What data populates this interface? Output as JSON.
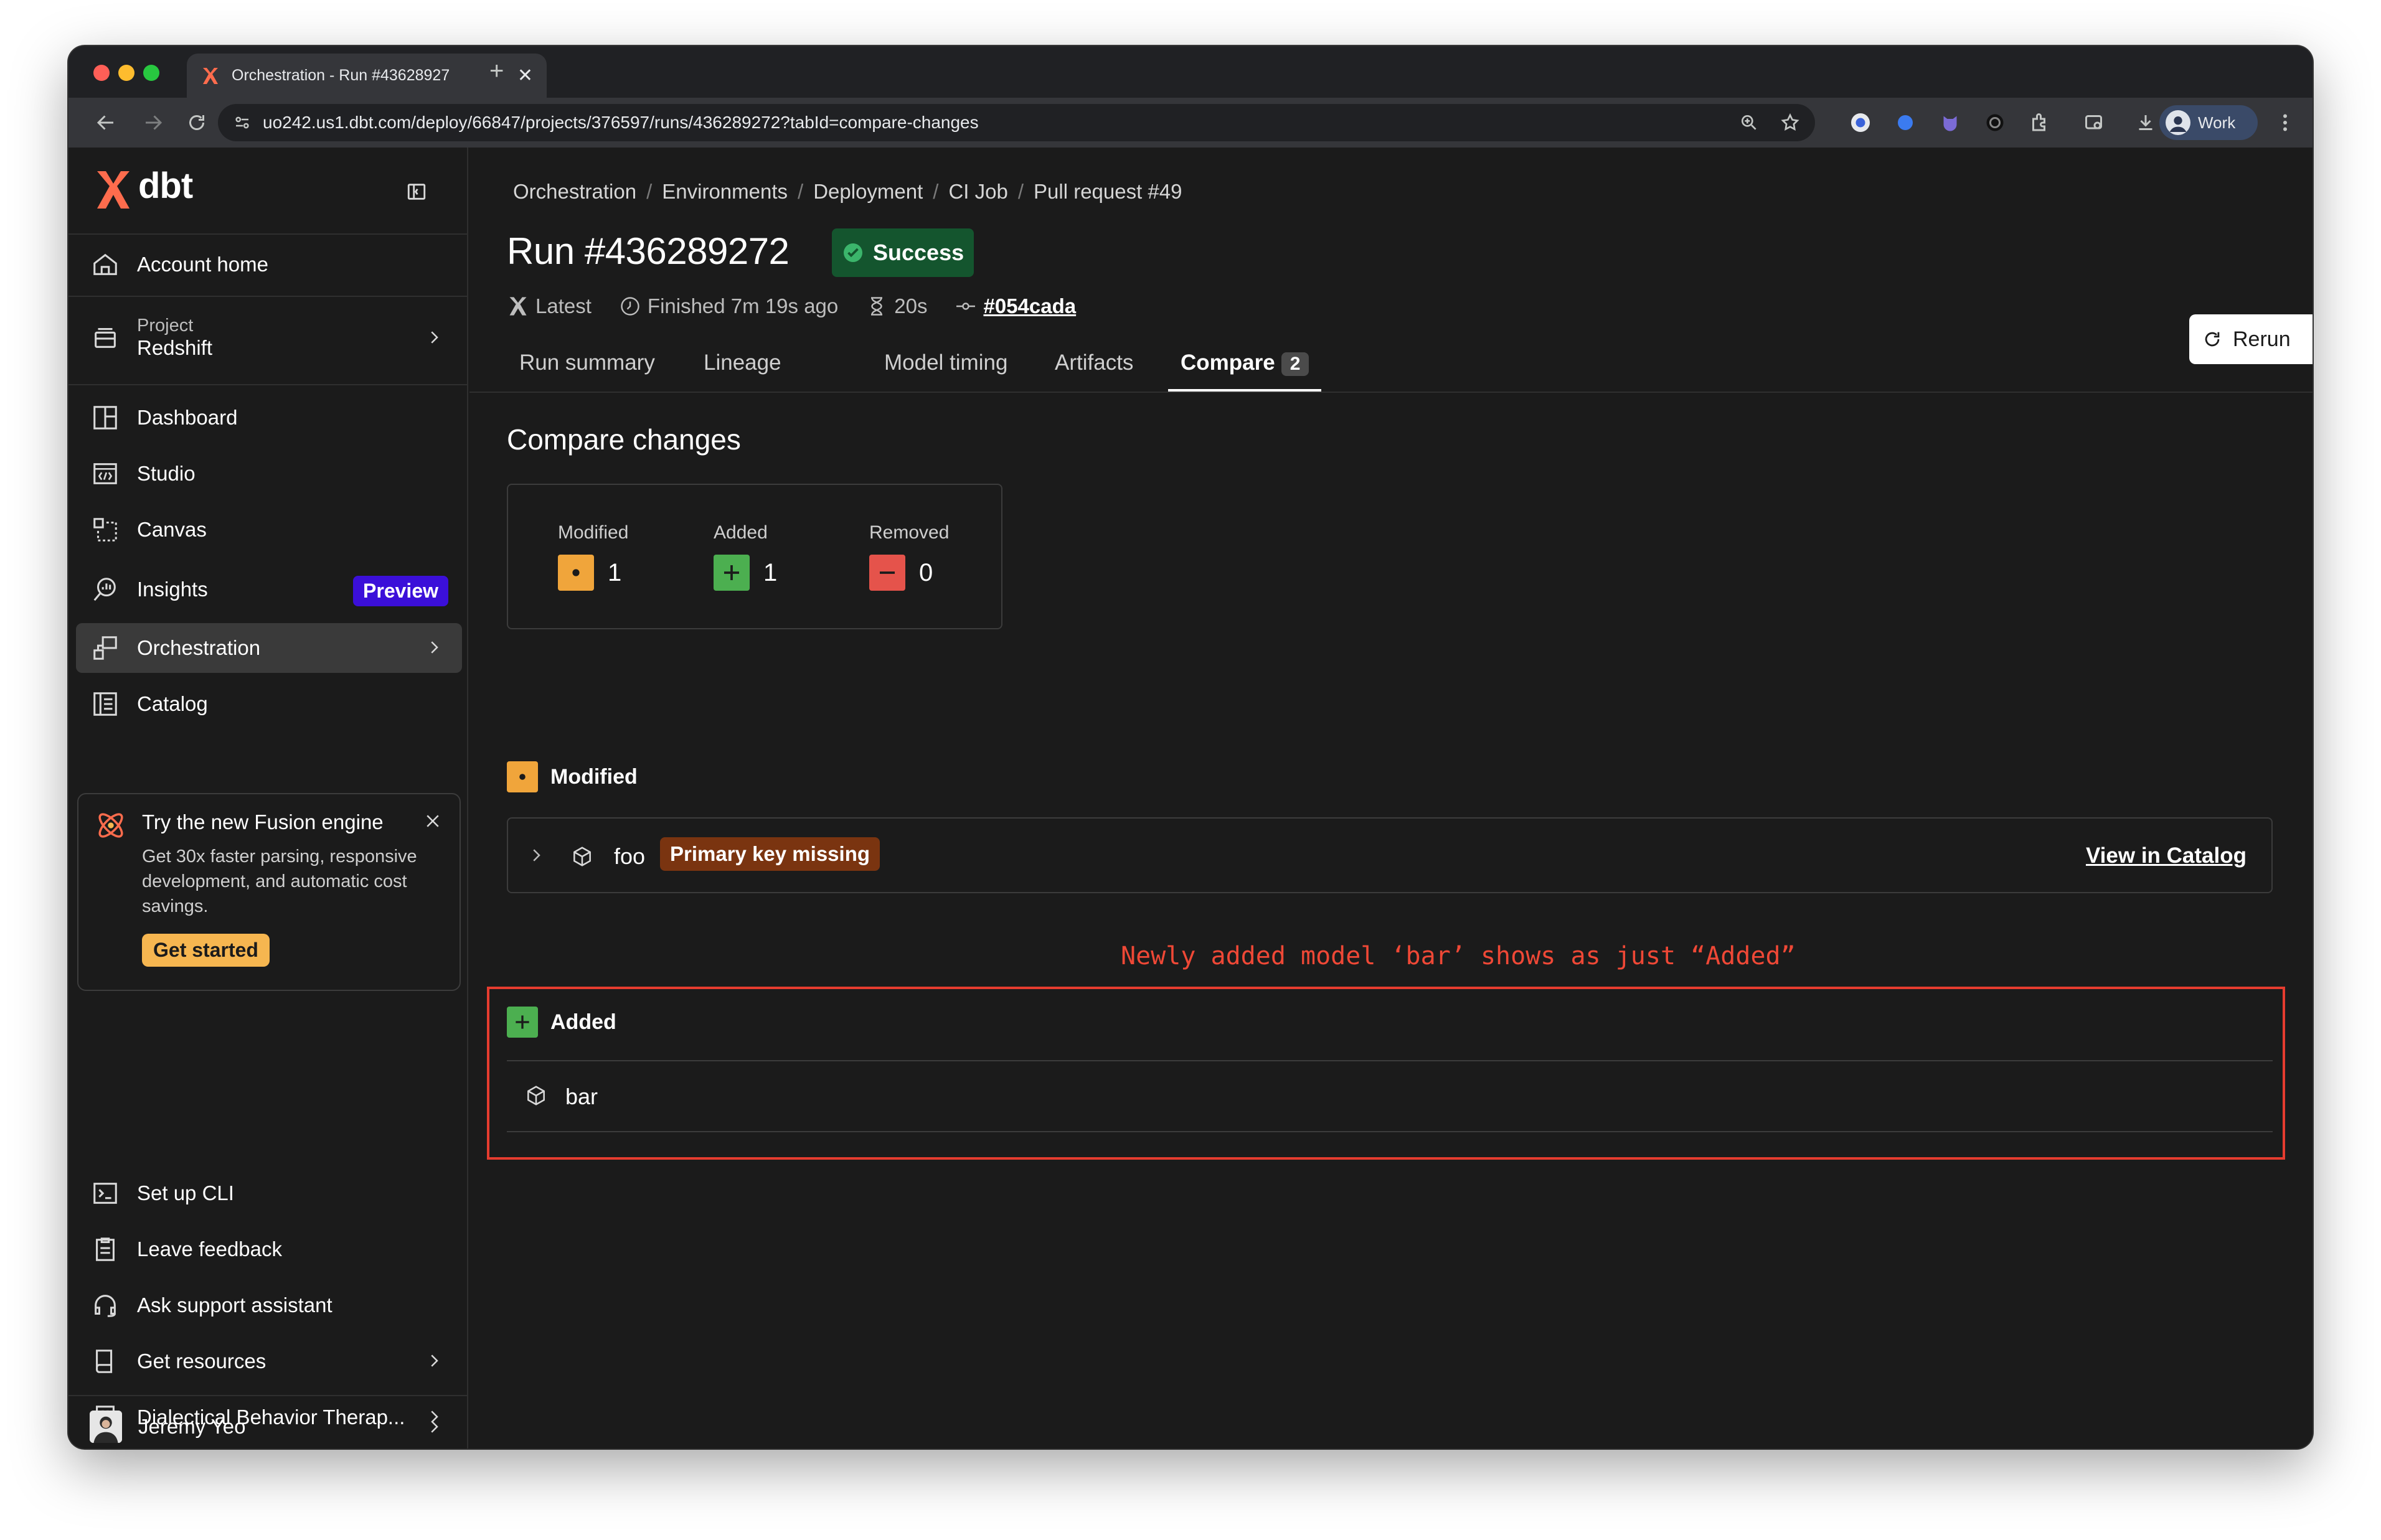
{
  "browser": {
    "tab_title": "Orchestration - Run #43628927",
    "url": "uo242.us1.dbt.com/deploy/66847/projects/376597/runs/436289272?tabId=compare-changes",
    "profile_label": "Work"
  },
  "sidebar": {
    "logo": "dbt",
    "account_home": "Account home",
    "project_caption": "Project",
    "project_name": "Redshift",
    "items": [
      {
        "label": "Dashboard"
      },
      {
        "label": "Studio"
      },
      {
        "label": "Canvas"
      },
      {
        "label": "Insights",
        "badge": "Preview"
      },
      {
        "label": "Orchestration"
      },
      {
        "label": "Catalog"
      }
    ],
    "promo": {
      "title": "Try the new Fusion engine",
      "body": "Get 30x faster parsing, responsive development, and automatic cost savings.",
      "button": "Get started"
    },
    "bottom_items": [
      {
        "label": "Set up CLI"
      },
      {
        "label": "Leave feedback"
      },
      {
        "label": "Ask support assistant"
      },
      {
        "label": "Get resources"
      },
      {
        "label": "Dialectical Behavior Therap..."
      }
    ],
    "user_name": "Jeremy Yeo"
  },
  "main": {
    "breadcrumbs": [
      "Orchestration",
      "Environments",
      "Deployment",
      "CI Job",
      "Pull request #49"
    ],
    "run_title": "Run #436289272",
    "status": "Success",
    "meta": {
      "latest": "Latest",
      "finished": "Finished 7m 19s ago",
      "duration": "20s",
      "commit": "#054cada"
    },
    "rerun_label": "Rerun",
    "tabs": [
      {
        "label": "Run summary"
      },
      {
        "label": "Lineage"
      },
      {
        "label": "Model timing"
      },
      {
        "label": "Artifacts"
      },
      {
        "label": "Compare",
        "count": "2"
      }
    ],
    "section_title": "Compare changes",
    "stats": {
      "modified_label": "Modified",
      "modified_value": "1",
      "added_label": "Added",
      "added_value": "1",
      "removed_label": "Removed",
      "removed_value": "0"
    },
    "modified_group": {
      "label": "Modified",
      "model": "foo",
      "badge": "Primary key missing",
      "link": "View in Catalog"
    },
    "annotation": "Newly added model ‘bar’ shows as just “Added”",
    "added_group": {
      "label": "Added",
      "model": "bar"
    }
  },
  "colors": {
    "modified": "#f0a53b",
    "added": "#4caf50",
    "removed": "#e5534b",
    "annotation": "#ef4836",
    "preview_badge": "#3b0fd9",
    "success_badge": "#14552e"
  }
}
